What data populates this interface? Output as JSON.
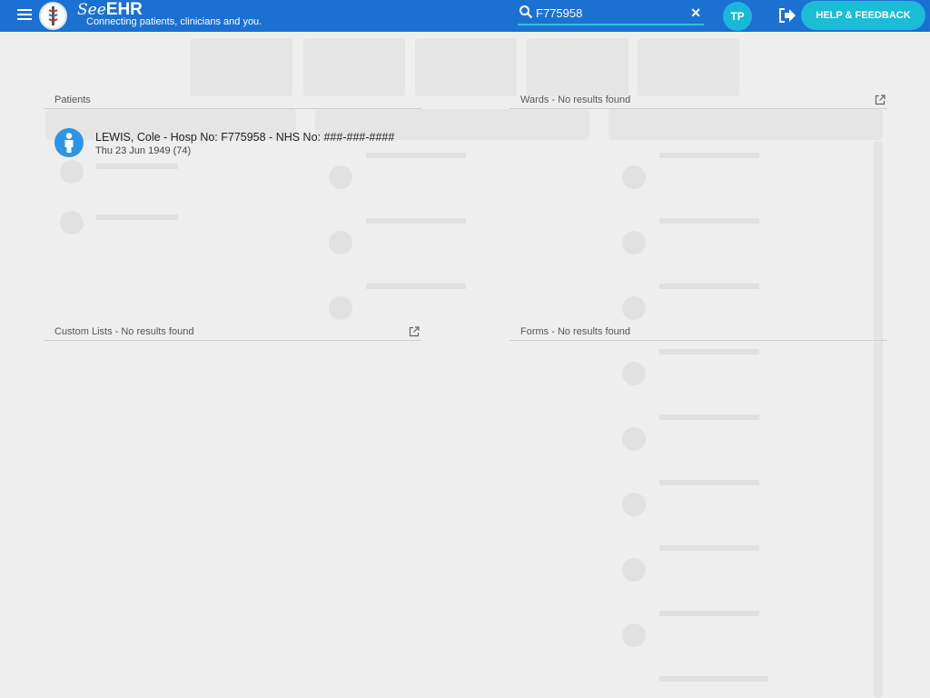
{
  "app": {
    "brand_see": "See",
    "brand_ehr": "EHR",
    "tagline": "Connecting patients, clinicians and you."
  },
  "search": {
    "value": "F775958",
    "placeholder": "Search"
  },
  "user": {
    "initials": "TP"
  },
  "header": {
    "help_label": "HELP & FEEDBACK"
  },
  "results": {
    "patients": {
      "title": "Patients",
      "items": [
        {
          "name_line": "LEWIS, Cole - Hosp No: F775958 - NHS No: ###-###-####",
          "dob_line": "Thu 23 Jun 1949 (74)"
        }
      ]
    },
    "wards": {
      "title": "Wards - No results found"
    },
    "custom_lists": {
      "title": "Custom Lists - No results found"
    },
    "forms": {
      "title": "Forms - No results found"
    }
  },
  "colors": {
    "topbar": "#1b70d2",
    "accent": "#1abcd6",
    "patient_icon": "#2d95e8",
    "background": "#eeeeee"
  },
  "icons": [
    "menu-icon",
    "search-icon",
    "close-icon",
    "logout-icon",
    "external-link-icon",
    "patient-icon"
  ]
}
